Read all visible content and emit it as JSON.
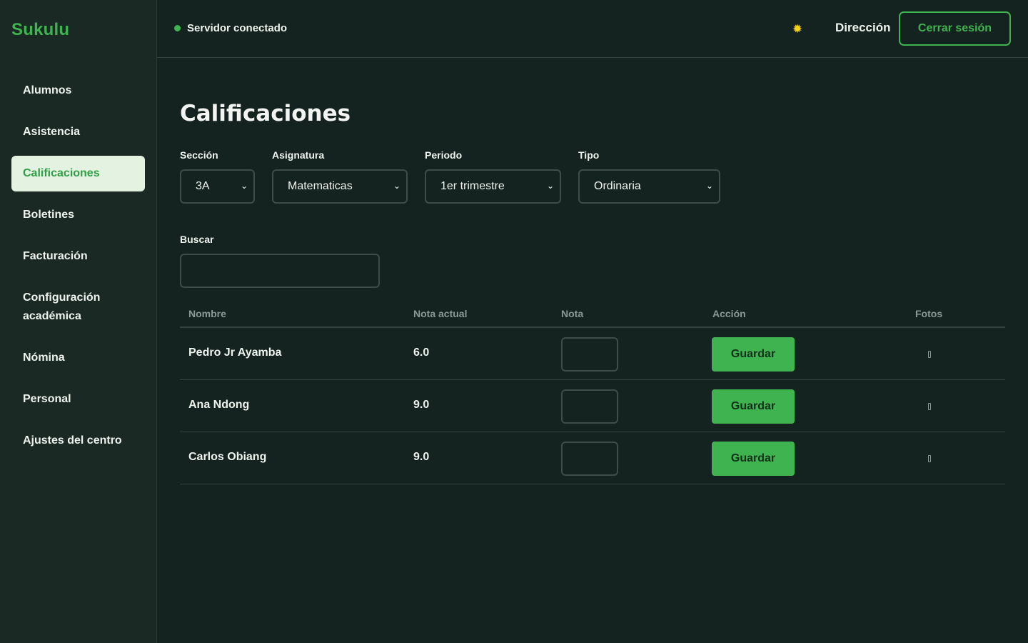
{
  "app": {
    "brand": "Sukulu"
  },
  "sidebar": {
    "items": [
      {
        "label": "Alumnos"
      },
      {
        "label": "Asistencia"
      },
      {
        "label": "Calificaciones"
      },
      {
        "label": "Boletines"
      },
      {
        "label": "Facturación"
      },
      {
        "label": "Configuración académica"
      },
      {
        "label": "Nómina"
      },
      {
        "label": "Personal"
      },
      {
        "label": "Ajustes del centro"
      }
    ],
    "active": "Calificaciones"
  },
  "header": {
    "status": "Servidor conectado",
    "theme_icon": "sun-icon",
    "role": "Dirección",
    "logout_label": "Cerrar sesión"
  },
  "page": {
    "title": "Calificaciones",
    "filters": {
      "seccion": {
        "label": "Sección",
        "value": "3A"
      },
      "asignatura": {
        "label": "Asignatura",
        "value": "Matematicas"
      },
      "periodo": {
        "label": "Periodo",
        "value": "1er trimestre"
      },
      "tipo": {
        "label": "Tipo",
        "value": "Ordinaria"
      }
    },
    "search": {
      "label": "Buscar",
      "value": "",
      "placeholder": ""
    }
  },
  "table": {
    "columns": [
      "Nombre",
      "Nota actual",
      "Nota",
      "Acción",
      "Fotos"
    ],
    "save_label": "Guardar",
    "rows": [
      {
        "name": "Pedro Jr Ayamba",
        "grade": "6.0",
        "new_grade": ""
      },
      {
        "name": "Ana Ndong",
        "grade": "9.0",
        "new_grade": ""
      },
      {
        "name": "Carlos Obiang",
        "grade": "9.0",
        "new_grade": ""
      }
    ]
  },
  "colors": {
    "accent": "#3fb34f",
    "background": "#152320",
    "sidebar": "#1a2924",
    "active_item_bg": "#e4f3e1",
    "theme_icon": "#f2d21a"
  }
}
